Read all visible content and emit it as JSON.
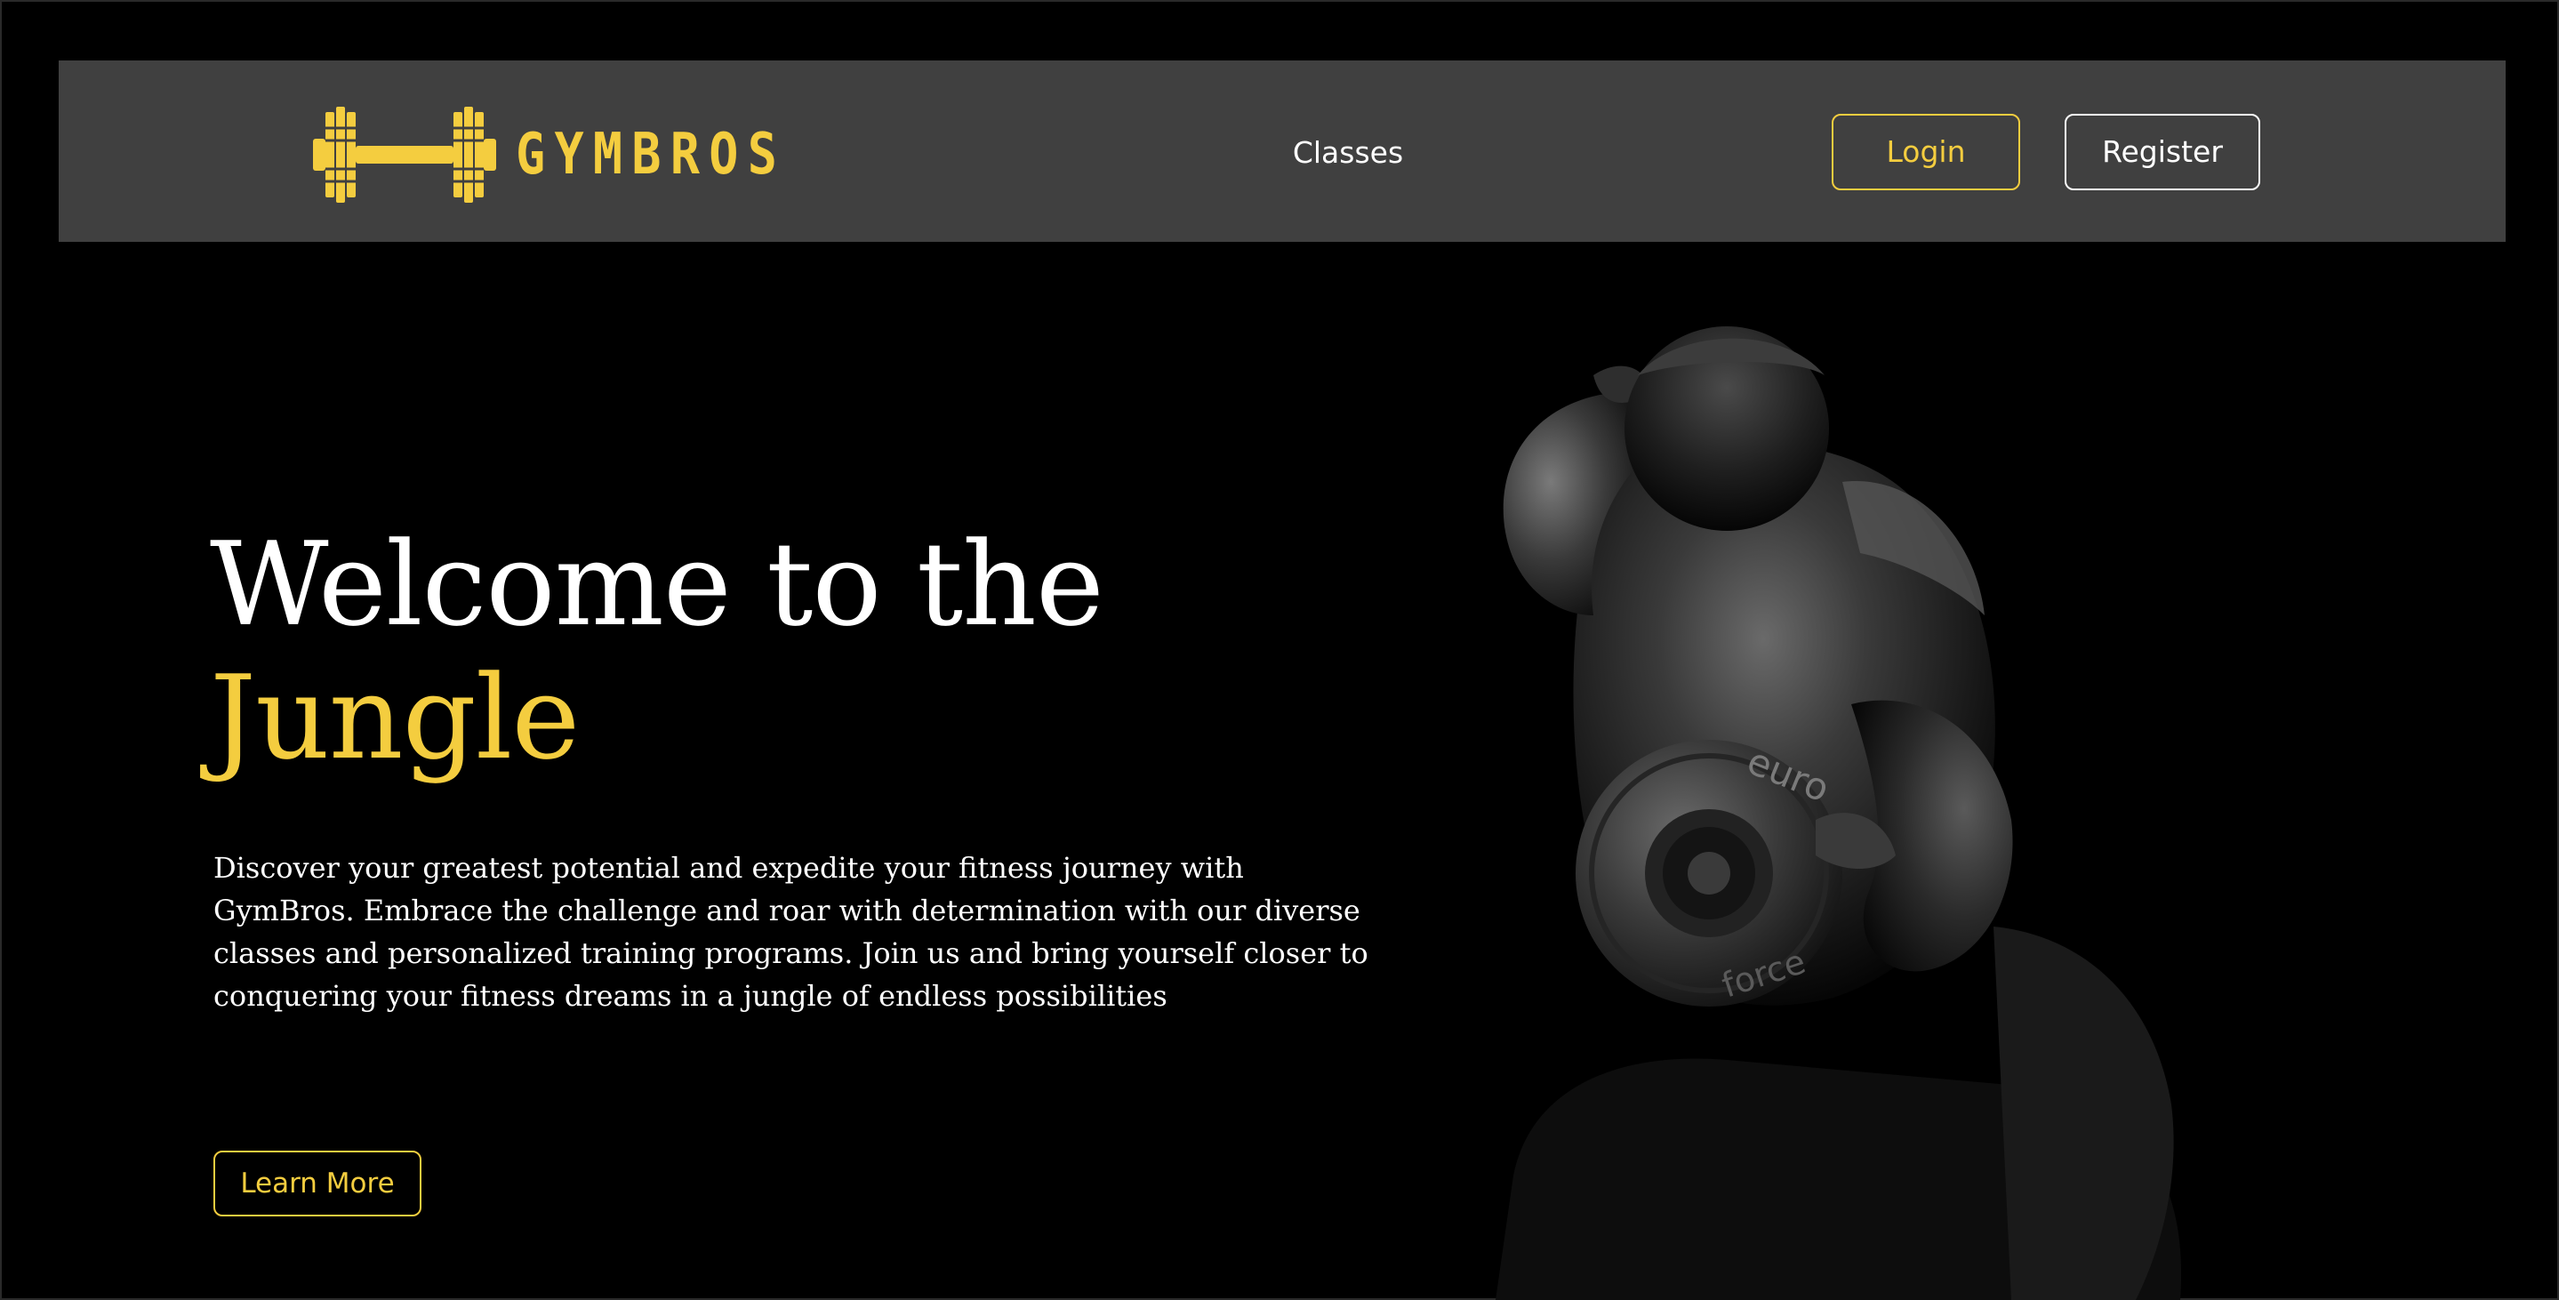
{
  "navbar": {
    "logo_text": "GYMBROS",
    "links": [
      {
        "label": "Classes"
      }
    ],
    "login_label": "Login",
    "register_label": "Register"
  },
  "hero": {
    "title_line1": "Welcome to the",
    "title_line2": "Jungle",
    "description": "Discover your greatest potential and expedite your fitness journey with GymBros. Embrace the challenge and roar with determination with our diverse classes and personalized training programs. Join us and bring yourself closer to conquering your fitness dreams in a jungle of endless possibilities",
    "cta_label": "Learn More",
    "image_icon": "weightlifter-photo",
    "plate_text_1": "euro",
    "plate_text_2": "force"
  },
  "colors": {
    "accent": "#f4cd3f",
    "background": "#000000",
    "navbar": "#404040",
    "text": "#ffffff"
  }
}
